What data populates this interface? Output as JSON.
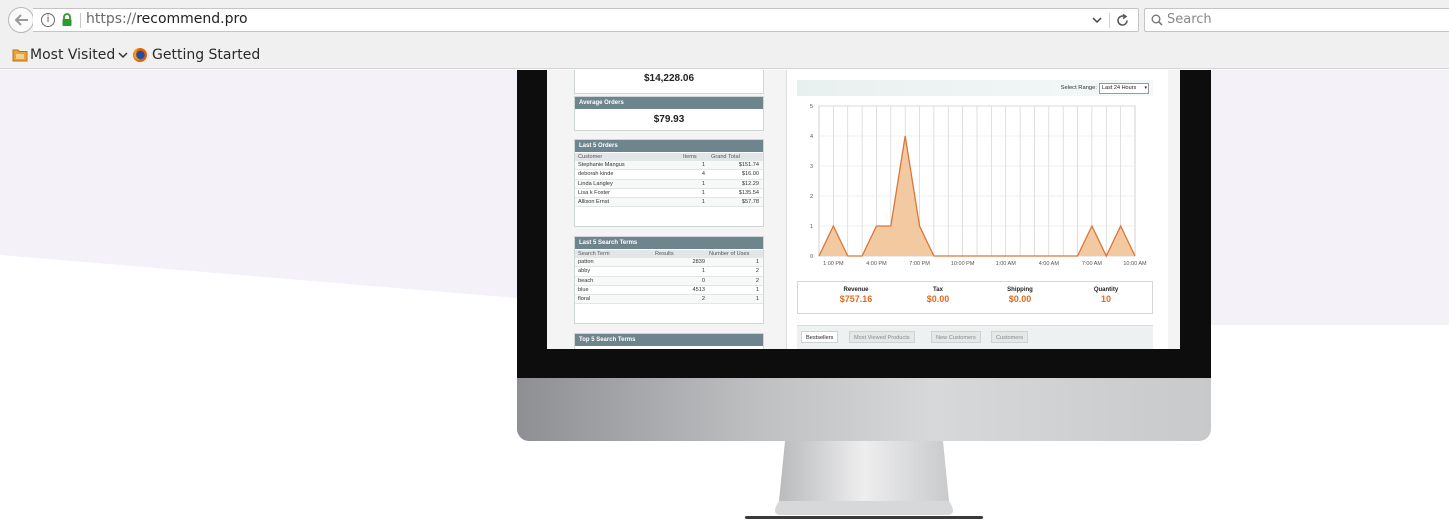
{
  "browser": {
    "url_scheme": "https://",
    "url_host": "recommend.pro",
    "search_placeholder": "Search",
    "bookmarks": [
      {
        "label": "Most Visited",
        "icon": "folder-icon"
      },
      {
        "label": "Getting Started",
        "icon": "firefox-icon"
      }
    ]
  },
  "dashboard": {
    "lifetime_sales_value": "$14,228.06",
    "average_orders": {
      "title": "Average Orders",
      "value": "$79.93"
    },
    "last_orders": {
      "title": "Last 5 Orders",
      "columns": [
        "Customer",
        "Items",
        "Grand Total"
      ],
      "rows": [
        [
          "Stephanie Mangus",
          "1",
          "$151.74"
        ],
        [
          "deborah kinde",
          "4",
          "$16.00"
        ],
        [
          "Linda Langley",
          "1",
          "$12.29"
        ],
        [
          "Lisa k Foster",
          "1",
          "$135.54"
        ],
        [
          "Allison Ernst",
          "1",
          "$57.78"
        ]
      ]
    },
    "last_search_terms": {
      "title": "Last 5 Search Terms",
      "columns": [
        "Search Term",
        "Results",
        "Number of Uses"
      ],
      "rows": [
        [
          "patton",
          "2839",
          "1"
        ],
        [
          "abby",
          "1",
          "2"
        ],
        [
          "beach",
          "0",
          "2"
        ],
        [
          "blue",
          "4513",
          "1"
        ],
        [
          "floral",
          "2",
          "1"
        ]
      ]
    },
    "top_search_terms": {
      "title": "Top 5 Search Terms"
    },
    "range": {
      "label": "Select Range:",
      "selected": "Last 24 Hours"
    },
    "totals": [
      {
        "label": "Revenue",
        "value": "$757.16"
      },
      {
        "label": "Tax",
        "value": "$0.00"
      },
      {
        "label": "Shipping",
        "value": "$0.00"
      },
      {
        "label": "Quantity",
        "value": "10"
      }
    ],
    "tabs": [
      "Bestsellers",
      "Most Viewed Products",
      "New Customers",
      "Customers"
    ]
  },
  "chart_data": {
    "type": "area",
    "x": [
      "12:00 PM",
      "1:00 PM",
      "2:00 PM",
      "3:00 PM",
      "4:00 PM",
      "5:00 PM",
      "6:00 PM",
      "7:00 PM",
      "8:00 PM",
      "9:00 PM",
      "10:00 PM",
      "11:00 PM",
      "12:00 AM",
      "1:00 AM",
      "2:00 AM",
      "3:00 AM",
      "4:00 AM",
      "5:00 AM",
      "6:00 AM",
      "7:00 AM",
      "8:00 AM",
      "9:00 AM",
      "10:00 AM"
    ],
    "tick_labels": [
      "1:00 PM",
      "4:00 PM",
      "7:00 PM",
      "10:00 PM",
      "1:00 AM",
      "4:00 AM",
      "7:00 AM",
      "10:00 AM"
    ],
    "y": [
      0,
      1,
      0,
      0,
      1,
      1,
      4,
      1,
      0,
      0,
      0,
      0,
      0,
      0,
      0,
      0,
      0,
      0,
      0,
      1,
      0,
      1,
      0
    ],
    "ylim": [
      0,
      5
    ],
    "yticks": [
      0,
      1,
      2,
      3,
      4,
      5
    ],
    "grid": true,
    "colors": {
      "fill": "#f2c9a1",
      "line": "#d9773a"
    }
  }
}
